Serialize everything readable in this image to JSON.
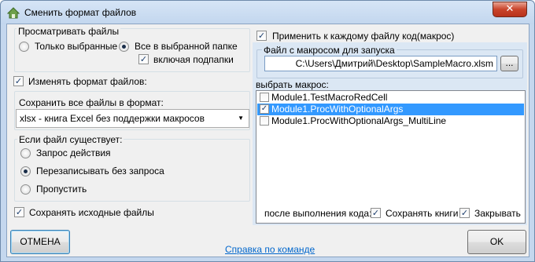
{
  "window": {
    "title": "Сменить формат файлов",
    "close_glyph": "✕"
  },
  "browse": {
    "legend": "Просматривать файлы",
    "option_selected_only": "Только выбранные",
    "option_all_in_folder": "Все в выбранной папке",
    "selected_option": "all_in_folder",
    "include_subfolders_label": "включая подпапки",
    "include_subfolders_checked": true
  },
  "change_format": {
    "label": "Изменять формат файлов:",
    "checked": true,
    "save_as_label": "Сохранить все файлы в формат:",
    "format_value": "xlsx - книга Excel без поддержки макросов",
    "if_exists": {
      "legend": "Если файл существует:",
      "options": [
        "Запрос действия",
        "Перезаписывать без запроса",
        "Пропустить"
      ],
      "selected_index": 1
    }
  },
  "keep_originals": {
    "label": "Сохранять исходные файлы",
    "checked": true
  },
  "macro": {
    "apply_label": "Применить к каждому файлу код(макрос)",
    "apply_checked": true,
    "file_legend": "Файл с макросом для запуска",
    "file_path": "C:\\Users\\Дмитрий\\Desktop\\SampleMacro.xlsm",
    "browse_button": "...",
    "choose_label": "выбрать макрос:",
    "items": [
      {
        "label": "Module1.TestMacroRedCell",
        "checked": false,
        "selected": false
      },
      {
        "label": "Module1.ProcWithOptionalArgs",
        "checked": true,
        "selected": true
      },
      {
        "label": "Module1.ProcWithOptionalArgs_MultiLine",
        "checked": false,
        "selected": false
      }
    ],
    "after_label": "после выполнения кода:",
    "save_books_label": "Сохранять книги",
    "save_books_checked": true,
    "close_label": "Закрывать",
    "close_checked": true
  },
  "footer": {
    "cancel": "ОТМЕНА",
    "help_link": "Справка по команде",
    "ok": "OK"
  },
  "colors": {
    "accent": "#3399ff",
    "link": "#0066cc",
    "panel": "#dbe7f4",
    "close_button": "#c9442b"
  }
}
